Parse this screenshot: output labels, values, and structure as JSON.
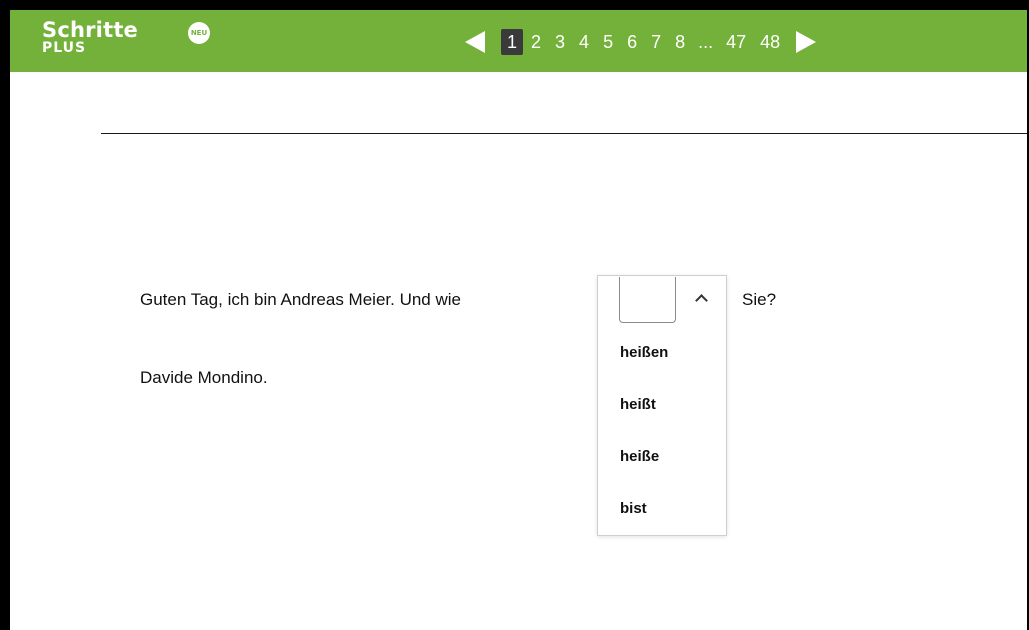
{
  "header": {
    "logo_line1": "Schritte",
    "logo_line2": "PLUS",
    "badge": "NEU",
    "colors": {
      "bar": "#74b13a",
      "active_page_bg": "#3a3a3a"
    }
  },
  "pagination": {
    "prev_icon": "triangle-left",
    "next_icon": "triangle-right",
    "pages": [
      "1",
      "2",
      "3",
      "4",
      "5",
      "6",
      "7",
      "8",
      "...",
      "47",
      "48"
    ],
    "current": "1"
  },
  "exercise": {
    "sentence_before": "Guten Tag, ich bin Andreas Meier. Und wie",
    "sentence_after": "Sie?",
    "answer_line": "Davide Mondino.",
    "dropdown": {
      "value": "",
      "icon": "chevron-up-icon",
      "options": [
        "heißen",
        "heißt",
        "heiße",
        "bist"
      ]
    }
  }
}
